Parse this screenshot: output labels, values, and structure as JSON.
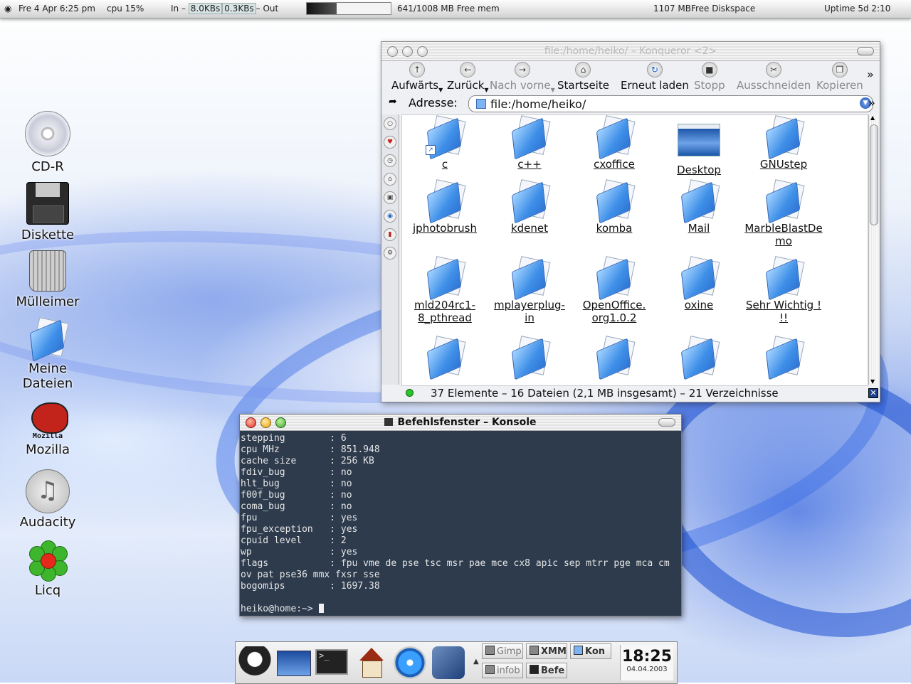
{
  "topbar": {
    "datetime": "Fre 4 Apr 6:25 pm",
    "cpu": "cpu 15%",
    "net_in_label": "In –",
    "net_in_value": "8.0KBs",
    "net_out_value": "0.3KBs",
    "net_out_label": "– Out",
    "mem_used_fraction": 0.36,
    "mem": "641/1008 MB Free mem",
    "disk": "1107 MBFree Diskspace",
    "uptime": "Uptime  5d 2:10"
  },
  "desktop_icons": [
    {
      "label": "CD-R",
      "icon": "cd-icon"
    },
    {
      "label": "Diskette",
      "icon": "floppy-icon"
    },
    {
      "label": "Mülleimer",
      "icon": "trash-icon"
    },
    {
      "label": "Meine Dateien",
      "icon": "folder-icon"
    },
    {
      "label": "Mozilla",
      "icon": "mozilla-icon",
      "badge": "Mozilla"
    },
    {
      "label": "Audacity",
      "icon": "audacity-icon"
    },
    {
      "label": "Licq",
      "icon": "licq-icon"
    }
  ],
  "konqueror": {
    "title": "file:/home/heiko/ – Konqueror <2>",
    "toolbar": {
      "up": "Aufwärts",
      "back": "Zurück",
      "forward": "Nach vorne",
      "home": "Startseite",
      "reload": "Erneut laden",
      "stop": "Stopp",
      "cut": "Ausschneiden",
      "copy": "Kopieren",
      "more": "»"
    },
    "address_label": "Adresse:",
    "address_value": "file:/home/heiko/",
    "files": [
      {
        "name": "c",
        "type": "folder-link"
      },
      {
        "name": "c++",
        "type": "folder"
      },
      {
        "name": "cxoffice",
        "type": "folder"
      },
      {
        "name": "Desktop",
        "type": "desktop"
      },
      {
        "name": "GNUstep",
        "type": "folder"
      },
      {
        "name": "jphotobrush",
        "type": "folder"
      },
      {
        "name": "kdenet",
        "type": "folder"
      },
      {
        "name": "komba",
        "type": "folder"
      },
      {
        "name": "Mail",
        "type": "folder"
      },
      {
        "name": "MarbleBlastDe",
        "name2": "mo",
        "type": "folder"
      },
      {
        "name": "mld204rc1-",
        "name2": "8_pthread",
        "type": "folder"
      },
      {
        "name": "mplayerplug-",
        "name2": "in",
        "type": "folder"
      },
      {
        "name": "OpenOffice.",
        "name2": "org1.0.2",
        "type": "folder"
      },
      {
        "name": "oxine",
        "type": "folder"
      },
      {
        "name": "Sehr Wichtig !",
        "name2": "!!",
        "type": "folder"
      }
    ],
    "status": "37 Elemente – 16 Dateien (2,1 MB insgesamt) – 21 Verzeichnisse"
  },
  "konsole": {
    "title": "Befehlsfenster – Konsole",
    "lines": [
      "stepping        : 6",
      "cpu MHz         : 851.948",
      "cache size      : 256 KB",
      "fdiv_bug        : no",
      "hlt_bug         : no",
      "f00f_bug        : no",
      "coma_bug        : no",
      "fpu             : yes",
      "fpu_exception   : yes",
      "cpuid level     : 2",
      "wp              : yes",
      "flags           : fpu vme de pse tsc msr pae mce cx8 apic sep mtrr pge mca cm",
      "ov pat pse36 mmx fxsr sse",
      "bogomips        : 1697.38",
      ""
    ],
    "prompt": "heiko@home:~> "
  },
  "kicker": {
    "tasks": [
      "Gimp",
      "XMM",
      "Kon",
      "infob",
      "Befe"
    ],
    "clock_time": "18:25",
    "clock_date": "04.04.2003"
  }
}
